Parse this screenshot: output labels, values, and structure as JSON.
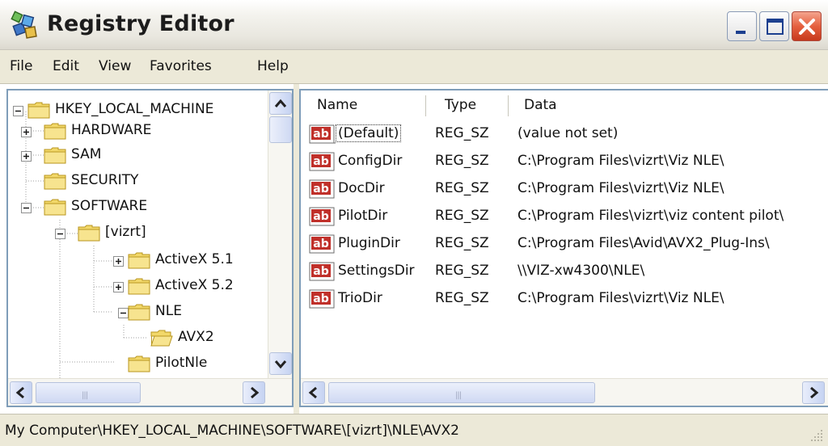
{
  "window": {
    "title": "Registry Editor",
    "icon": "registry-editor-icon"
  },
  "menu": {
    "items": [
      {
        "label": "File"
      },
      {
        "label": "Edit"
      },
      {
        "label": "View"
      },
      {
        "label": "Favorites"
      },
      {
        "label": "Help"
      }
    ]
  },
  "tree": {
    "nodes": [
      {
        "label": "HKEY_LOCAL_MACHINE",
        "expander": "minus",
        "folder": "closed"
      },
      {
        "label": "HARDWARE",
        "expander": "plus",
        "folder": "closed"
      },
      {
        "label": "SAM",
        "expander": "plus",
        "folder": "closed"
      },
      {
        "label": "SECURITY",
        "expander": "none",
        "folder": "closed"
      },
      {
        "label": "SOFTWARE",
        "expander": "minus",
        "folder": "closed"
      },
      {
        "label": "[vizrt]",
        "expander": "minus",
        "folder": "closed"
      },
      {
        "label": "ActiveX 5.1",
        "expander": "plus",
        "folder": "closed"
      },
      {
        "label": "ActiveX 5.2",
        "expander": "plus",
        "folder": "closed"
      },
      {
        "label": "NLE",
        "expander": "minus",
        "folder": "closed"
      },
      {
        "label": "AVX2",
        "expander": "none",
        "folder": "open",
        "selected": true
      },
      {
        "label": "PilotNle",
        "expander": "none",
        "folder": "closed"
      }
    ]
  },
  "list": {
    "columns": [
      "Name",
      "Type",
      "Data"
    ],
    "rows": [
      {
        "name": "(Default)",
        "type": "REG_SZ",
        "data": "(value not set)",
        "focused": true
      },
      {
        "name": "ConfigDir",
        "type": "REG_SZ",
        "data": "C:\\Program Files\\vizrt\\Viz NLE\\"
      },
      {
        "name": "DocDir",
        "type": "REG_SZ",
        "data": "C:\\Program Files\\vizrt\\Viz NLE\\"
      },
      {
        "name": "PilotDir",
        "type": "REG_SZ",
        "data": "C:\\Program Files\\vizrt\\viz content pilot\\"
      },
      {
        "name": "PluginDir",
        "type": "REG_SZ",
        "data": "C:\\Program Files\\Avid\\AVX2_Plug-Ins\\"
      },
      {
        "name": "SettingsDir",
        "type": "REG_SZ",
        "data": "\\\\VIZ-xw4300\\NLE\\"
      },
      {
        "name": "TrioDir",
        "type": "REG_SZ",
        "data": "C:\\Program Files\\vizrt\\Viz NLE\\"
      }
    ],
    "value_icon": "string-value-ab-icon"
  },
  "status": {
    "path": "My Computer\\HKEY_LOCAL_MACHINE\\SOFTWARE\\[vizrt]\\NLE\\AVX2"
  },
  "colors": {
    "folder": "#f2d86a",
    "folder_edge": "#b8961f",
    "border": "#7f9db9",
    "chrome": "#ece9d8"
  }
}
